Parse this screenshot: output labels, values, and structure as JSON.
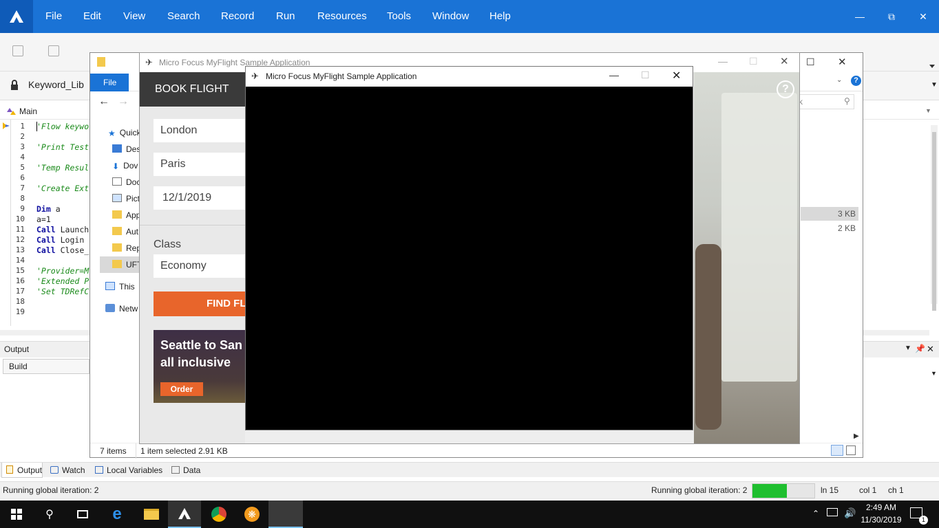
{
  "uft": {
    "menu": [
      "File",
      "Edit",
      "View",
      "Search",
      "Record",
      "Run",
      "Resources",
      "Tools",
      "Window",
      "Help"
    ],
    "doc_tab": "Keyword_Lib",
    "breadcrumb": "Main",
    "code_lines": [
      {
        "n": "1",
        "text": "'Flow keywo",
        "type": "comment"
      },
      {
        "n": "2",
        "text": "",
        "type": "plain"
      },
      {
        "n": "3",
        "text": "'Print Test",
        "type": "comment"
      },
      {
        "n": "4",
        "text": "",
        "type": "plain"
      },
      {
        "n": "5",
        "text": "'Temp Resul",
        "type": "comment"
      },
      {
        "n": "6",
        "text": "",
        "type": "plain"
      },
      {
        "n": "7",
        "text": "'Create Ext",
        "type": "comment"
      },
      {
        "n": "8",
        "text": "",
        "type": "plain"
      },
      {
        "n": "9",
        "kw": "Dim",
        "rest": " a",
        "type": "kw"
      },
      {
        "n": "10",
        "text": "a=1",
        "type": "plain"
      },
      {
        "n": "11",
        "kw": "Call",
        "rest": " Launch",
        "type": "kw"
      },
      {
        "n": "12",
        "kw": "Call",
        "rest": " Login",
        "type": "kw"
      },
      {
        "n": "13",
        "kw": "Call",
        "rest": " Close_",
        "type": "kw"
      },
      {
        "n": "14",
        "text": "",
        "type": "plain"
      },
      {
        "n": "15",
        "text": "'Provider=M",
        "type": "comment"
      },
      {
        "n": "16",
        "text": "'Extended P",
        "type": "comment"
      },
      {
        "n": "17",
        "text": "'Set TDRefC",
        "type": "comment"
      },
      {
        "n": "18",
        "text": "",
        "type": "plain"
      },
      {
        "n": "19",
        "text": "",
        "type": "plain"
      }
    ],
    "output": {
      "title": "Output",
      "dropdown": "Build"
    },
    "bottom_tabs": [
      "Output",
      "Watch",
      "Local Variables",
      "Data"
    ],
    "status": {
      "left": "Running global iteration: 2",
      "right": "Running global iteration: 2",
      "progress": 0.55,
      "ln": "ln 15",
      "col": "col 1",
      "ch": "ch 1"
    }
  },
  "explorer": {
    "ribbon_file": "File",
    "search_placeholder": "rk",
    "sidebar": [
      "Quick",
      "Des",
      "Dov",
      "Doc",
      "Pict",
      "App",
      "Aut",
      "Rep",
      "UFT",
      "This",
      "Netw"
    ],
    "sizes": [
      "3 KB",
      "2 KB"
    ],
    "status_items": "7 items",
    "status_selected": "1 item selected  2.91 KB"
  },
  "myflight_back": {
    "title": "Micro Focus MyFlight Sample Application",
    "book_flight": "BOOK FLIGHT",
    "from": "London",
    "to": "Paris",
    "date": "12/1/2019",
    "class_label": "Class",
    "class_value": "Economy",
    "find_button": "FIND FL",
    "ad_line1": "Seattle to San",
    "ad_line2": "all inclusive",
    "ad_button": "Order",
    "help": "?"
  },
  "myflight_front": {
    "title": "Micro Focus MyFlight Sample Application"
  },
  "taskbar": {
    "time": "2:49 AM",
    "date": "11/30/2019",
    "notifications": "1"
  },
  "colors": {
    "uft_blue": "#1a73d6",
    "find_orange": "#e8652b",
    "progress_green": "#1fbf2f"
  }
}
